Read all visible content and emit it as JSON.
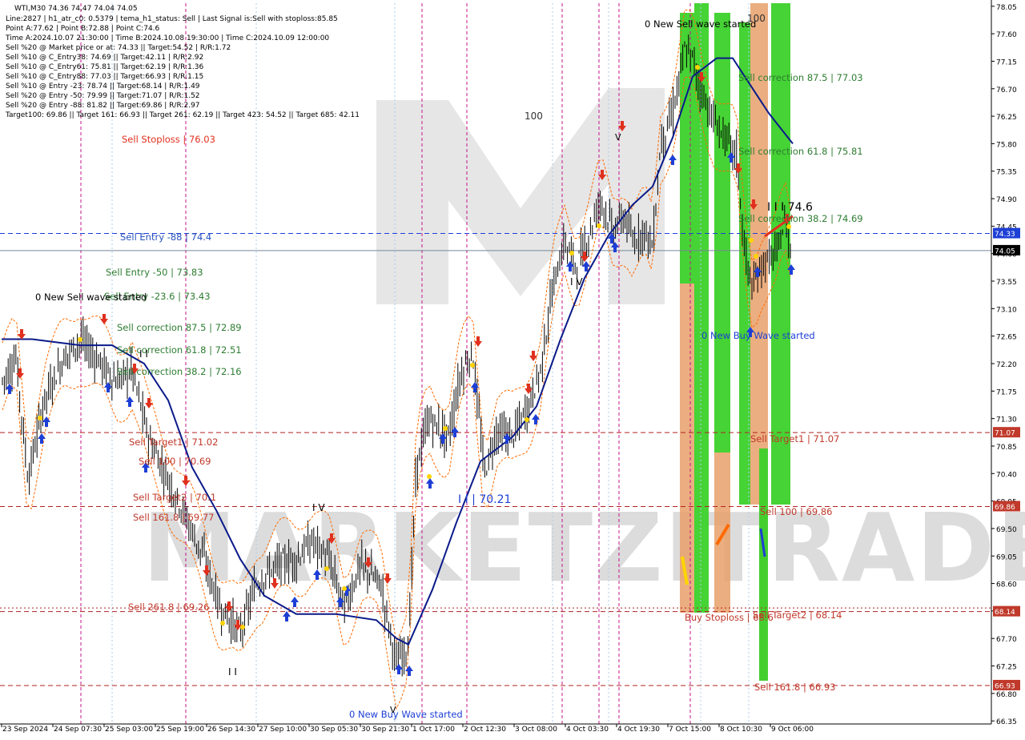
{
  "chart_data": {
    "type": "candlestick",
    "symbol_line": "WTI,M30  74.36 74.47 74.04 74.05",
    "info_lines": [
      "Line:2827 | h1_atr_c0: 0.5379 | tema_h1_status: Sell | Last Signal is:Sell with stoploss:85.85",
      "Point A:77.62 | Point B:72.88 | Point C:74.6",
      "Time A:2024.10.07 21:30:00 | Time B:2024.10.08 19:30:00 | Time C:2024.10.09 12:00:00",
      "Sell %20 @ Market price or at: 74.33 || Target:54.52 | R/R:1.72",
      "Sell %10 @ C_Entry38: 74.69 || Target:42.11 | R/R:2.92",
      "Sell %10 @ C_Entry61: 75.81 || Target:62.19 | R/R:1.36",
      "Sell %10 @ C_Entry88: 77.03 || Target:66.93 | R/R:1.15",
      "Sell %10 @ Entry -23: 78.74 || Target:68.14 | R/R:1.49",
      "Sell %20 @ Entry -50: 79.99 || Target:71.07 | R/R:1.52",
      "Sell %20 @ Entry -88: 81.82 || Target:69.86 | R/R:2.97",
      "Target100: 69.86 || Target 161: 66.93 || Target 261: 62.19 || Target 423: 54.52 || Target 685: 42.11"
    ],
    "y_ticks": [
      "78.05",
      "77.60",
      "77.15",
      "76.70",
      "76.25",
      "75.80",
      "75.35",
      "74.90",
      "74.45",
      "74.00",
      "73.55",
      "73.10",
      "72.65",
      "72.20",
      "71.75",
      "71.30",
      "70.85",
      "70.40",
      "69.95",
      "69.50",
      "69.05",
      "68.60",
      "68.15",
      "67.70",
      "67.25",
      "66.80",
      "66.35"
    ],
    "ylim": [
      66.3,
      78.1
    ],
    "x_ticks": [
      "23 Sep 2024",
      "24 Sep 07:30",
      "25 Sep 03:00",
      "25 Sep 19:00",
      "26 Sep 14:30",
      "27 Sep 10:00",
      "30 Sep 05:30",
      "30 Sep 21:30",
      "1 Oct 17:00",
      "2 Oct 12:30",
      "3 Oct 08:00",
      "4 Oct 03:30",
      "4 Oct 19:30",
      "7 Oct 15:00",
      "8 Oct 10:30",
      "9 Oct 06:00"
    ],
    "price_tags": [
      {
        "label": "74.33",
        "value": 74.33,
        "bg": "#1d3fd6"
      },
      {
        "label": "74.05",
        "value": 74.05,
        "bg": "#000000"
      },
      {
        "label": "71.07",
        "value": 71.07,
        "bg": "#c0392b"
      },
      {
        "label": "69.86",
        "value": 69.86,
        "bg": "#c0392b"
      },
      {
        "label": "68.14",
        "value": 68.14,
        "bg": "#c0392b"
      },
      {
        "label": "66.93",
        "value": 66.93,
        "bg": "#c0392b"
      }
    ],
    "horizontal_levels": [
      {
        "value": 74.33,
        "color": "#1d3fd6",
        "style": "dashed"
      },
      {
        "value": 74.05,
        "color": "#778899",
        "style": "solid"
      },
      {
        "value": 71.07,
        "color": "#b22222",
        "style": "dashed"
      },
      {
        "value": 69.86,
        "color": "#b22222",
        "style": "dashed"
      },
      {
        "value": 68.14,
        "color": "#b22222",
        "style": "dashed"
      },
      {
        "value": 66.93,
        "color": "#b22222",
        "style": "dashed"
      }
    ],
    "annotations": [
      {
        "text": "Sell Stoploss | 76.03",
        "color": "#e0301e"
      },
      {
        "text": "Sell Entry -88 | 74.4",
        "color": "#2a52be"
      },
      {
        "text": "Sell Entry -50 | 73.83",
        "color": "#2e7d32"
      },
      {
        "text": "Sell Entry -23.6 | 73.43",
        "color": "#2e7d32"
      },
      {
        "text": "0 New Sell wave started",
        "color": "#000000"
      },
      {
        "text": "Sell correction 87.5 | 72.89",
        "color": "#2e7d32"
      },
      {
        "text": "Sell correction 61.8 | 72.51",
        "color": "#2e7d32"
      },
      {
        "text": "Sell correction 38.2 | 72.16",
        "color": "#2e7d32"
      },
      {
        "text": "Sell Target1 | 71.02",
        "color": "#c0392b"
      },
      {
        "text": "Sell 100 | 70.69",
        "color": "#c0392b"
      },
      {
        "text": "Sell Target2 | 70.1",
        "color": "#c0392b"
      },
      {
        "text": "Sell 161.8 | 69.77",
        "color": "#c0392b"
      },
      {
        "text": "Sell  261.8 | 69.26",
        "color": "#c0392b"
      },
      {
        "text": "0 New Buy Wave started",
        "color": "#1d3fd6"
      },
      {
        "text": "I I | 70.21",
        "color": "#1d3fd6"
      },
      {
        "text": "100",
        "color": "#333333"
      },
      {
        "text": "0 New Sell wave started",
        "color": "#000000"
      },
      {
        "text": "100",
        "color": "#333333"
      },
      {
        "text": "Sell correction 87.5 | 77.03",
        "color": "#2e7d32"
      },
      {
        "text": "Sell correction 61.8 | 75.81",
        "color": "#2e7d32"
      },
      {
        "text": "I I I 74.6",
        "color": "#000000"
      },
      {
        "text": "Sell correction 38.2 | 74.69",
        "color": "#2e7d32"
      },
      {
        "text": "0 New Buy Wave started",
        "color": "#1d3fd6"
      },
      {
        "text": "Sell Target1 | 71.07",
        "color": "#c0392b"
      },
      {
        "text": "Sell 100 | 69.86",
        "color": "#c0392b"
      },
      {
        "text": "Buy Stoploss | 68.6",
        "color": "#c0392b"
      },
      {
        "text": "Sell Target2 | 68.14",
        "color": "#c0392b"
      },
      {
        "text": "Sell 161.8 | 66.93",
        "color": "#c0392b"
      }
    ],
    "watermark": "MARKETZITRADE",
    "colors": {
      "ma_line": "#0a1a8a",
      "green_zone": "#3cd12a",
      "orange_zone": "#e8a06a",
      "candle": "#000000",
      "grid": "none"
    }
  }
}
